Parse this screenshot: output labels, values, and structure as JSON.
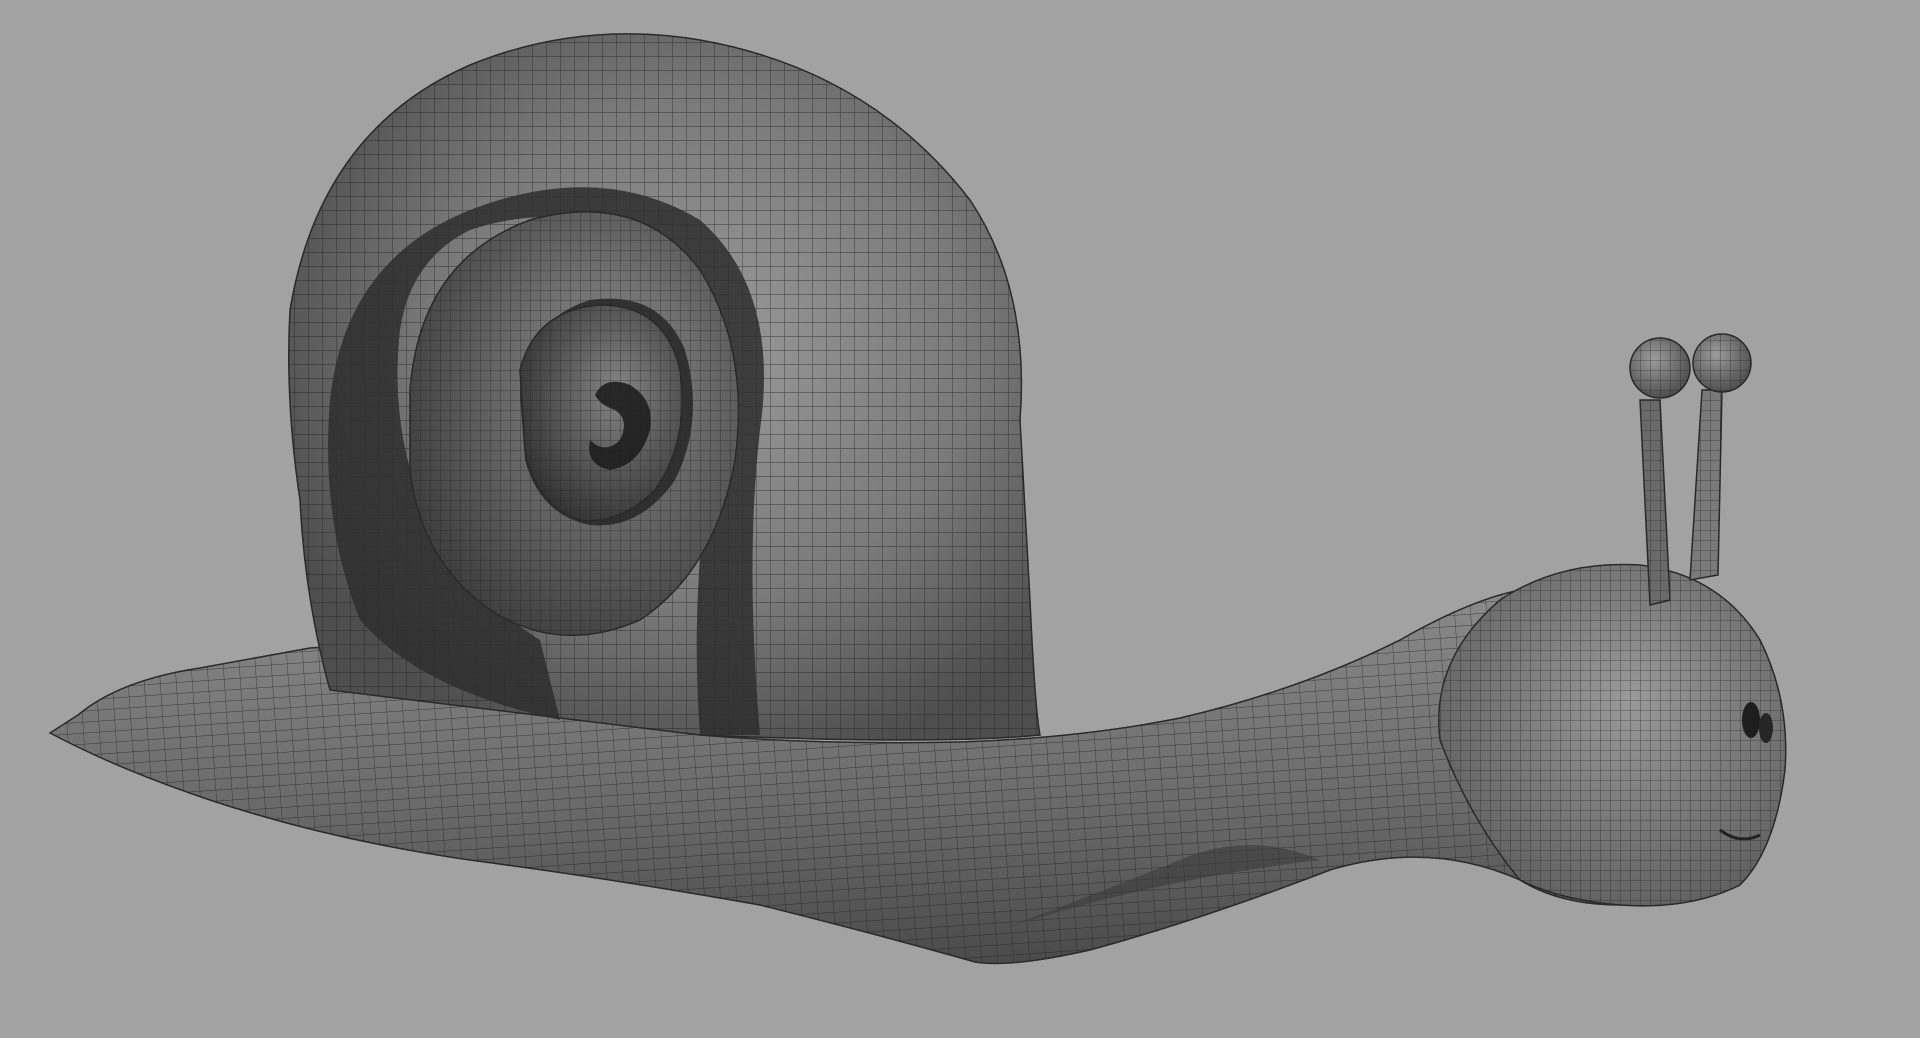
{
  "viewport": {
    "background_color": "#a2a2a2",
    "model": "snail",
    "display_mode": "wireframe-on-shaded",
    "wire_color": "#1a1a1a",
    "surface_color": "#6e6e6e"
  }
}
